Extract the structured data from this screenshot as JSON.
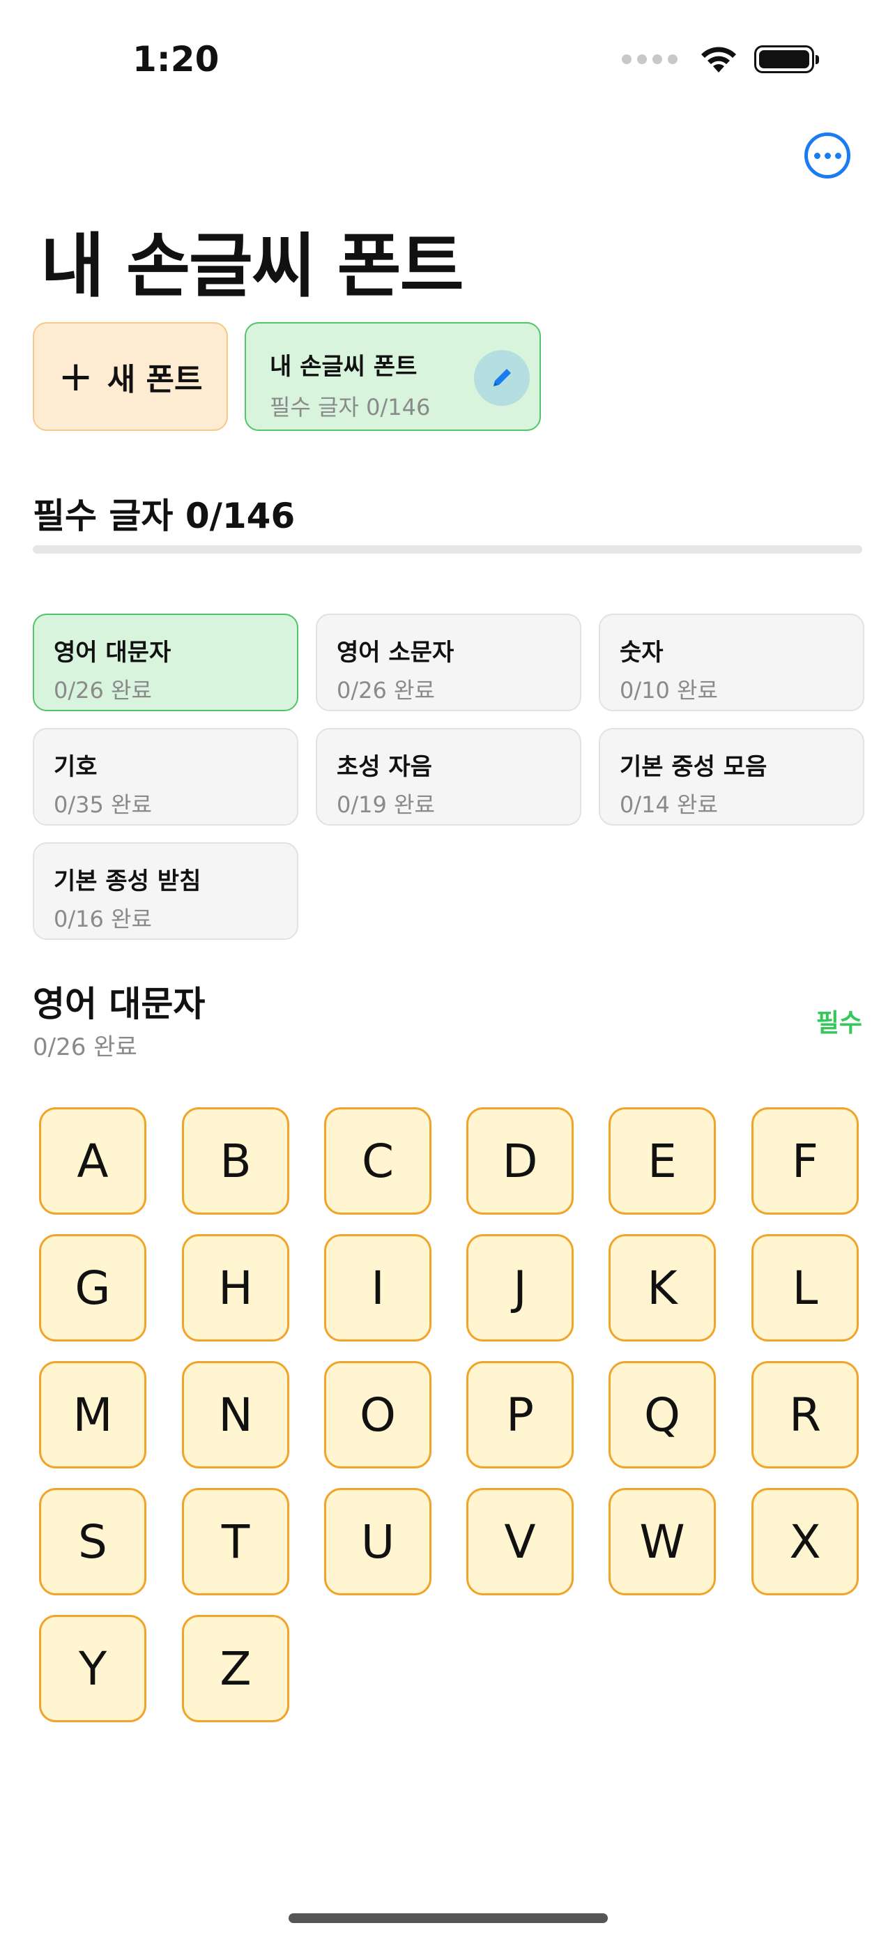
{
  "status_bar": {
    "time": "1:20"
  },
  "header": {
    "title": "내 손글씨 폰트"
  },
  "fonts": {
    "new_label": "새 폰트",
    "current": {
      "name": "내 손글씨 폰트",
      "progress": "필수 글자 0/146"
    }
  },
  "required": {
    "title": "필수 글자 0/146",
    "completed": 0,
    "total": 146
  },
  "categories": [
    {
      "name": "영어 대문자",
      "progress": "0/26 완료"
    },
    {
      "name": "영어 소문자",
      "progress": "0/26 완료"
    },
    {
      "name": "숫자",
      "progress": "0/10 완료"
    },
    {
      "name": "기호",
      "progress": "0/35 완료"
    },
    {
      "name": "초성 자음",
      "progress": "0/19 완료"
    },
    {
      "name": "기본 중성 모음",
      "progress": "0/14 완료"
    },
    {
      "name": "기본 종성 받침",
      "progress": "0/16 완료"
    }
  ],
  "detail": {
    "title": "영어 대문자",
    "progress": "0/26 완료",
    "badge": "필수"
  },
  "letters": [
    "A",
    "B",
    "C",
    "D",
    "E",
    "F",
    "G",
    "H",
    "I",
    "J",
    "K",
    "L",
    "M",
    "N",
    "O",
    "P",
    "Q",
    "R",
    "S",
    "T",
    "U",
    "V",
    "W",
    "X",
    "Y",
    "Z"
  ],
  "colors": {
    "accent": "#1a7cf0",
    "success": "#34c759",
    "tile_border": "#f0a52a"
  }
}
